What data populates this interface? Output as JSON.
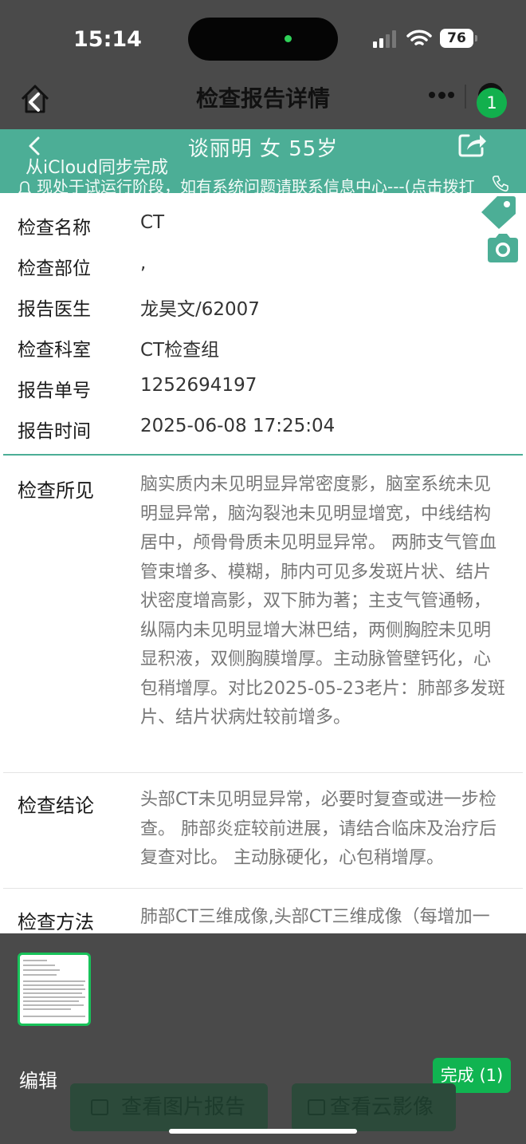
{
  "status_bar": {
    "time": "15:14",
    "battery": "76",
    "icons": [
      "signal-icon",
      "wifi-icon",
      "battery-icon"
    ]
  },
  "header": {
    "title": "检查报告详情",
    "badge": "1",
    "icons": [
      "home-back-icon",
      "more-icon",
      "capsule-icon"
    ]
  },
  "patient_bar": {
    "patient": "谈丽明  女  55岁",
    "sync_status": "从iCloud同步完成",
    "notice": "现处于试运行阶段，如有系统问题请联系信息中心---(点击拨打",
    "icons": [
      "back-chevron-icon",
      "share-icon",
      "bell-icon",
      "phone-icon"
    ]
  },
  "info": [
    {
      "label": "检查名称",
      "value": "CT"
    },
    {
      "label": "检查部位",
      "value": ","
    },
    {
      "label": "报告医生",
      "value": "龙昊文/62007"
    },
    {
      "label": "检查科室",
      "value": "CT检查组"
    },
    {
      "label": "报告单号",
      "value": "1252694197"
    },
    {
      "label": "报告时间",
      "value": "2025-06-08 17:25:04"
    }
  ],
  "sections": {
    "findings": {
      "label": "检查所见",
      "text": "脑实质内未见明显异常密度影，脑室系统未见明显异常，脑沟裂池未见明显增宽，中线结构居中，颅骨骨质未见明显异常。 两肺支气管血管束增多、模糊，肺内可见多发斑片状、结片状密度增高影，双下肺为著；主支气管通畅，纵隔内未见明显增大淋巴结，两侧胸腔未见明显积液，双侧胸膜增厚。主动脉管壁钙化，心包稍增厚。对比2025-05-23老片：肺部多发斑片、结片状病灶较前增多。"
    },
    "conclusion": {
      "label": "检查结论",
      "text": "头部CT未见明显异常，必要时复查或进一步检查。 肺部炎症较前进展，请结合临床及治疗后复查对比。 主动脉硬化，心包稍增厚。"
    },
    "method": {
      "label": "检查方法",
      "text": "肺部CT三维成像,头部CT三维成像（每增加一个部位）"
    }
  },
  "side_icons": [
    "tag-icon",
    "camera-icon"
  ],
  "bottom": {
    "edit_label": "编辑",
    "done_label": "完成 (1)",
    "image_report_label": "查看图片报告",
    "cloud_image_label": "查看云影像"
  },
  "colors": {
    "teal": "#4cae96",
    "green": "#10b451",
    "overlay": "#4a4a4a"
  }
}
